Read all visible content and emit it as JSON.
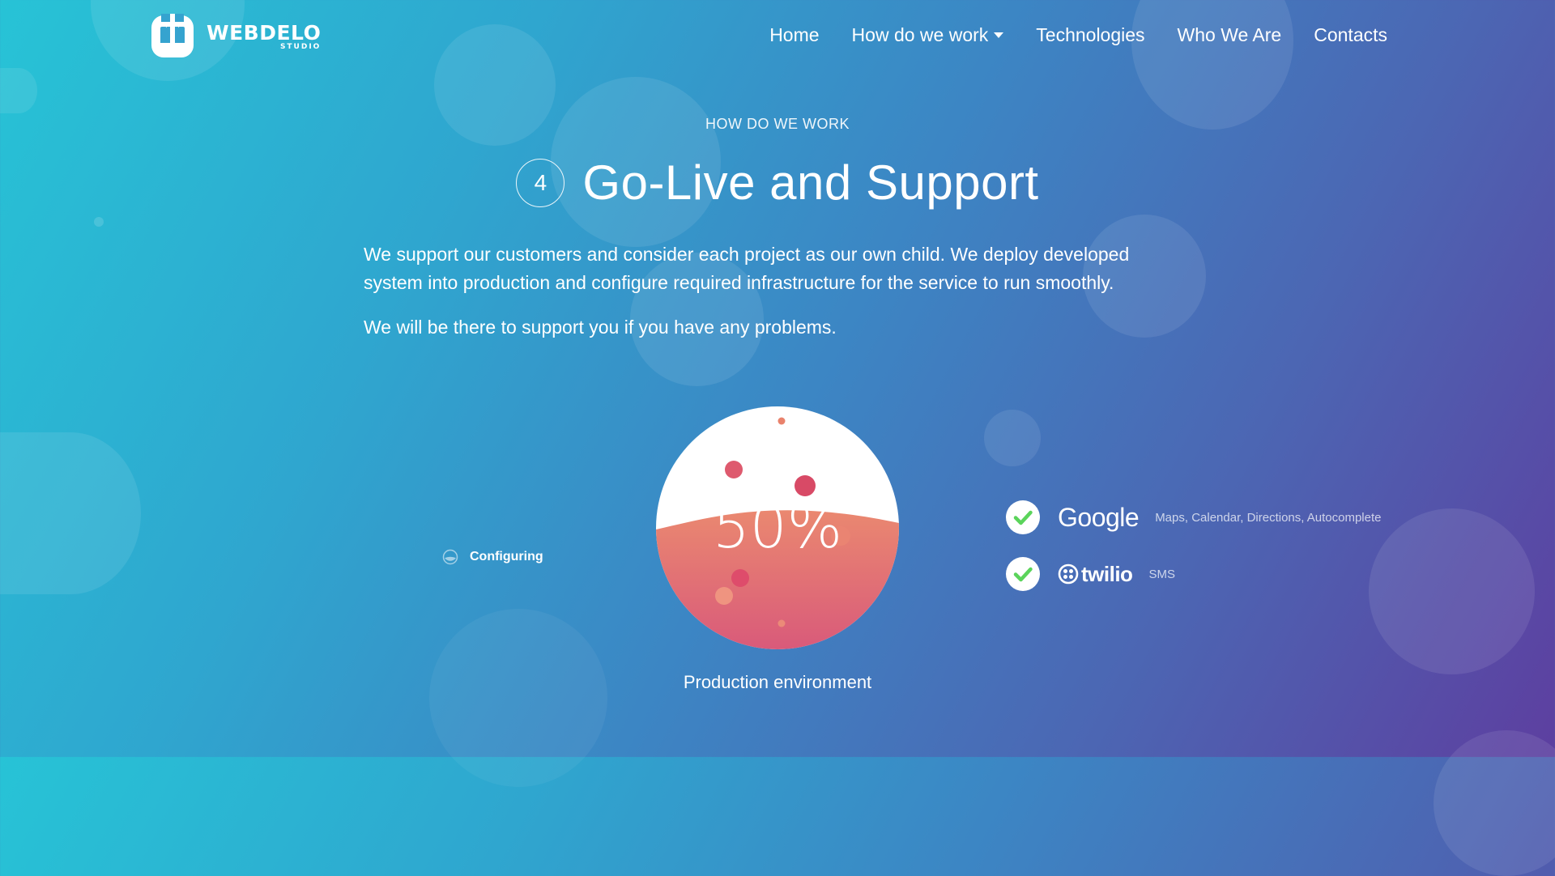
{
  "brand": {
    "name": "WEBDELO",
    "sub": "STUDIO"
  },
  "nav": {
    "home": "Home",
    "how": "How do we work",
    "technologies": "Technologies",
    "who": "Who We Are",
    "contacts": "Contacts"
  },
  "hero": {
    "eyebrow": "HOW DO WE WORK",
    "step": "4",
    "title": "Go-Live and Support",
    "paragraphs": [
      "We support our customers and consider each project as our own child. We deploy developed system into production and configure required infrastructure for the service to run smoothly.",
      "We will be there to support you if you have any problems."
    ]
  },
  "status": {
    "label": "Configuring",
    "icon": "spinner-icon"
  },
  "gauge": {
    "percent": 50,
    "percent_text": "50%",
    "label": "Production environment"
  },
  "services": [
    {
      "name": "Google",
      "desc": "Maps, Calendar, Directions, Autocomplete",
      "icon": "check-icon"
    },
    {
      "name": "twilio",
      "desc": "SMS",
      "icon": "check-icon"
    }
  ],
  "colors": {
    "liquid_top": "#ea8870",
    "liquid_bottom": "#d95a7a",
    "check_green": "#5bd45b"
  }
}
